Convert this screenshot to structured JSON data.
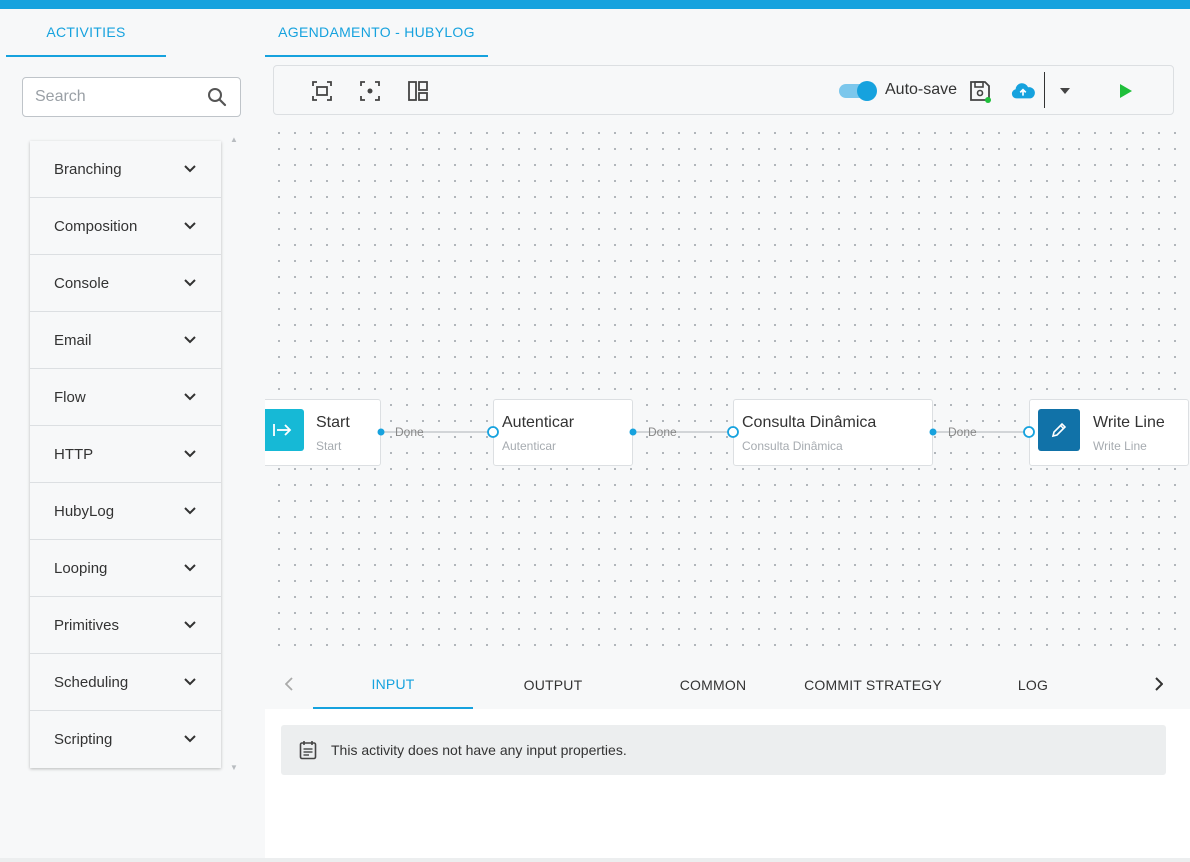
{
  "colors": {
    "accent": "#16a2de",
    "start_node": "#16b9d6",
    "writeline_node": "#1172a8",
    "run_green": "#1fbf3b"
  },
  "sidebar": {
    "tab_label": "ACTIVITIES",
    "search_placeholder": "Search",
    "categories": [
      {
        "label": "Branching"
      },
      {
        "label": "Composition"
      },
      {
        "label": "Console"
      },
      {
        "label": "Email"
      },
      {
        "label": "Flow"
      },
      {
        "label": "HTTP"
      },
      {
        "label": "HubyLog"
      },
      {
        "label": "Looping"
      },
      {
        "label": "Primitives"
      },
      {
        "label": "Scheduling"
      },
      {
        "label": "Scripting"
      }
    ]
  },
  "main": {
    "tab_label": "AGENDAMENTO - HUBYLOG",
    "toolbar": {
      "autosave_label": "Auto-save",
      "icons": [
        "fit-to-screen-icon",
        "center-icon",
        "auto-layout-icon",
        "save-icon",
        "cloud-upload-icon",
        "chevron-down-icon",
        "play-icon"
      ]
    },
    "nodes": [
      {
        "title": "Start",
        "subtitle": "Start",
        "icon": "start-arrow-icon"
      },
      {
        "title": "Autenticar",
        "subtitle": "Autenticar"
      },
      {
        "title": "Consulta Dinâmica",
        "subtitle": "Consulta Dinâmica"
      },
      {
        "title": "Write Line",
        "subtitle": "Write Line",
        "icon": "pencil-icon"
      }
    ],
    "edges": [
      {
        "label": "Done"
      },
      {
        "label": "Done"
      },
      {
        "label": "Done"
      }
    ]
  },
  "panel": {
    "tabs": [
      {
        "label": "INPUT",
        "active": true
      },
      {
        "label": "OUTPUT"
      },
      {
        "label": "COMMON"
      },
      {
        "label": "COMMIT STRATEGY"
      },
      {
        "label": "LOG"
      }
    ],
    "notice": "This activity does not have any input properties."
  }
}
